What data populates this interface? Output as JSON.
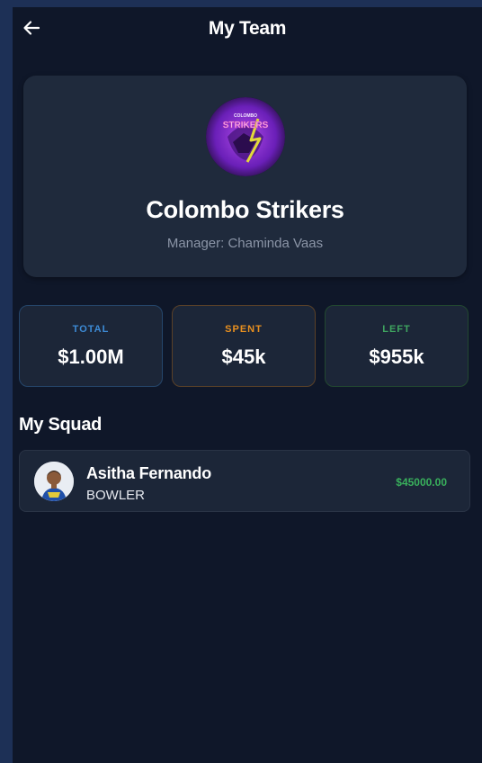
{
  "header": {
    "title": "My Team",
    "back_icon": "arrow-left-icon"
  },
  "team": {
    "name": "Colombo Strikers",
    "manager": "Manager: Chaminda Vaas",
    "logo": {
      "top_text": "COLOMBO",
      "main_text": "STRIKERS",
      "colors": [
        "#7b2bd6",
        "#e2d93a",
        "#e24cc6"
      ]
    }
  },
  "stats": {
    "total": {
      "label": "TOTAL",
      "value": "$1.00M",
      "color": "#3d8bd6"
    },
    "spent": {
      "label": "SPENT",
      "value": "$45k",
      "color": "#e9901f"
    },
    "left": {
      "label": "LEFT",
      "value": "$955k",
      "color": "#3fa660"
    }
  },
  "squad": {
    "title": "My Squad",
    "players": [
      {
        "name": "Asitha Fernando",
        "role": "BOWLER",
        "price": "$45000.00",
        "avatar_icon": "player-avatar-icon"
      }
    ]
  },
  "colors": {
    "background": "#0f1729",
    "outer_background": "#1d3056",
    "card": "#1f2a3c",
    "price_green": "#39b05c"
  }
}
